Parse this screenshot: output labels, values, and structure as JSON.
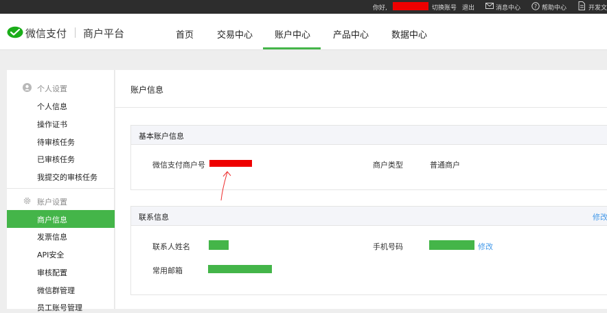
{
  "topbar": {
    "greeting": "你好,",
    "switch_account": "切换账号",
    "logout": "退出",
    "messages": "消息中心",
    "help": "帮助中心",
    "developer": "开发文"
  },
  "brand": {
    "name": "微信支付",
    "platform": "商户平台"
  },
  "nav": {
    "items": [
      "首页",
      "交易中心",
      "账户中心",
      "产品中心",
      "数据中心"
    ],
    "active": "账户中心"
  },
  "sidebar": {
    "group1": {
      "title": "个人设置",
      "items": [
        "个人信息",
        "操作证书",
        "待审核任务",
        "已审核任务",
        "我提交的审核任务"
      ]
    },
    "group2": {
      "title": "账户设置",
      "items": [
        "商户信息",
        "发票信息",
        "API安全",
        "审核配置",
        "微信群管理",
        "员工账号管理"
      ]
    },
    "active": "商户信息"
  },
  "main": {
    "title": "账户信息",
    "basic_card": {
      "title": "基本账户信息",
      "merchant_id_label": "微信支付商户号",
      "merchant_type_label": "商户类型",
      "merchant_type_value": "普通商户"
    },
    "contact_card": {
      "title": "联系信息",
      "edit_link": "修改",
      "name_label": "联系人姓名",
      "phone_label": "手机号码",
      "phone_edit": "修改",
      "email_label": "常用邮箱"
    }
  },
  "colors": {
    "accent_green": "#44b549",
    "redaction": "#ee0000",
    "link_blue": "#459ae9",
    "topbar_bg": "#2d2d2d"
  }
}
